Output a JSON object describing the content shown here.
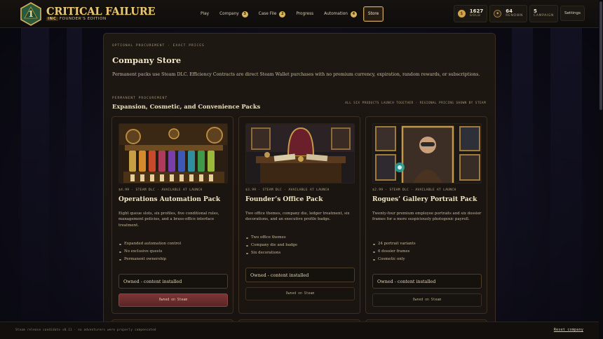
{
  "header": {
    "logo": {
      "die_number": "1",
      "title": "CRITICAL FAILURE",
      "subtitle_prefix": "INC",
      "subtitle": "FOUNDER'S EDITION"
    },
    "nav": [
      {
        "id": "play",
        "label": "Play",
        "badge": ""
      },
      {
        "id": "company",
        "label": "Company",
        "badge": "3"
      },
      {
        "id": "casefile",
        "label": "Case File",
        "badge": "2"
      },
      {
        "id": "progress",
        "label": "Progress",
        "badge": ""
      },
      {
        "id": "automation",
        "label": "Automation",
        "badge": "4"
      },
      {
        "id": "store",
        "label": "Store",
        "badge": "",
        "active": true
      }
    ],
    "stats": {
      "gold": {
        "value": "1627",
        "label": "GOLD"
      },
      "renown": {
        "value": "64",
        "label": "RENOWN"
      },
      "campaign": {
        "value": "5",
        "label": "CAMPAIGN"
      }
    },
    "settings_label": "Settings"
  },
  "store": {
    "kicker": "OPTIONAL PROCUREMENT · EXACT PRICES",
    "title": "Company Store",
    "description": "Permanent packs use Steam DLC. Efficiency Contracts are direct Steam Wallet purchases with no premium currency, expiration, random rewards, or subscriptions.",
    "section_kicker": "PERMANENT PROCUREMENT",
    "section_title": "Expansion, Cosmetic, and Convenience Packs",
    "section_note": "ALL SIX PRODUCTS LAUNCH TOGETHER · REGIONAL PRICING SHOWN BY STEAM"
  },
  "products": [
    {
      "meta": "$4.99 · STEAM DLC · AVAILABLE AT LAUNCH",
      "title": "Operations Automation Pack",
      "description": "Eight queue slots, six profiles, five conditional rules, management policies, and a brass-office interface treatment.",
      "features": [
        "Expanded automation control",
        "No exclusive quests",
        "Permanent ownership"
      ],
      "status": "Owned - content installed",
      "button": "Owned on Steam"
    },
    {
      "meta": "$3.99 · STEAM DLC · AVAILABLE AT LAUNCH",
      "title": "Founder’s Office Pack",
      "description": "Two office themes, company die, ledger treatment, six decorations, and an executive profile badge.",
      "features": [
        "Two office themes",
        "Company die and badge",
        "Six decorations"
      ],
      "status": "Owned - content installed",
      "button": "Owned on Steam"
    },
    {
      "meta": "$2.99 · STEAM DLC · AVAILABLE AT LAUNCH",
      "title": "Rogues’ Gallery Portrait Pack",
      "description": "Twenty-four premium employee portraits and six dossier frames for a more suspiciously photogenic payroll.",
      "features": [
        "24 portrait variants",
        "6 dossier frames",
        "Cosmetic only"
      ],
      "status": "Owned - content installed",
      "button": "Owned on Steam"
    }
  ],
  "footer": {
    "note": "Steam release candidate v0.11 · no adventurers were properly compensated",
    "reset_label": "Reset company"
  },
  "colors": {
    "accent_gold": "#d9b45a",
    "primary_button": "#6b2d2d",
    "panel_bg": "#1b1511"
  }
}
